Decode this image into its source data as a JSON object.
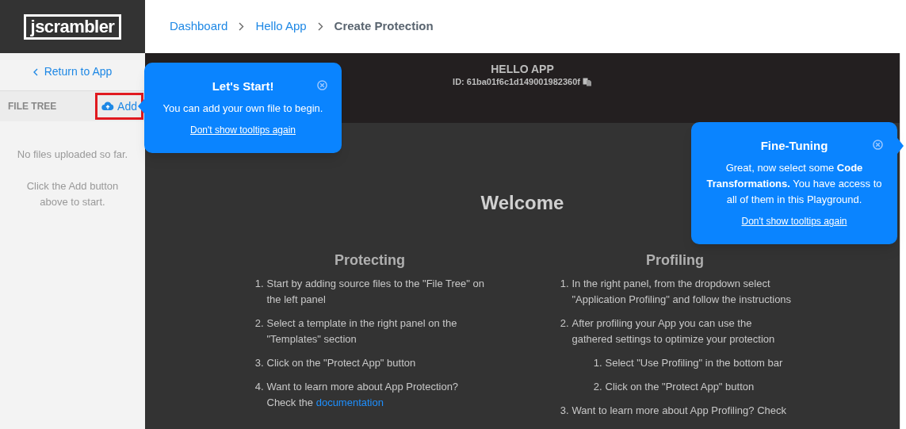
{
  "header": {
    "logo": "jscrambler",
    "breadcrumbs": [
      {
        "label": "Dashboard",
        "current": false
      },
      {
        "label": "Hello App",
        "current": false
      },
      {
        "label": "Create Protection",
        "current": true
      }
    ]
  },
  "sidebar": {
    "return_link": "Return to App",
    "section_title": "FILE TREE",
    "add_button": "Add",
    "add_highlighted": true,
    "empty_messages": [
      "No files uploaded so far.",
      "Click the Add button above to start."
    ]
  },
  "app_banner": {
    "title": "HELLO APP",
    "id": "ID: 61ba01f6c1d149001982360f"
  },
  "welcome": {
    "title": "Welcome",
    "columns": [
      {
        "title": "Protecting",
        "items": [
          {
            "number": "1.",
            "text": "Start by adding source files to the \"File Tree\" on the left panel"
          },
          {
            "number": "2.",
            "text": "Select a template in the right panel on the \"Templates\" section"
          },
          {
            "number": "3.",
            "text": "Click on the \"Protect App\" button"
          },
          {
            "number": "4.",
            "text": "Want to learn more about App Protection? Check the",
            "link": "documentation"
          }
        ]
      },
      {
        "title": "Profiling",
        "items": [
          {
            "number": "1.",
            "text": "In the right panel, from the dropdown select \"Application Profiling\" and follow the instructions"
          },
          {
            "number": "2.",
            "text": "After profiling your App you can use the gathered settings to optimize your protection",
            "children": [
              {
                "number": "1.",
                "text": "Select \"Use Profiling\" in the bottom bar"
              },
              {
                "number": "2.",
                "text": "Click on the \"Protect App\" button"
              }
            ]
          },
          {
            "number": "3.",
            "text": "Want to learn more about App Profiling? Check"
          }
        ]
      }
    ]
  },
  "tooltips": [
    {
      "title": "Let's Start!",
      "body": "You can add your own file to begin.",
      "link": "Don't show tooltips again",
      "kind": "left"
    },
    {
      "title": "Fine-Tuning",
      "body": "Great, now select some **Code Transformations.** You have access to all of them in this Playground.",
      "link": "Don't show tooltips again",
      "kind": "right"
    }
  ]
}
